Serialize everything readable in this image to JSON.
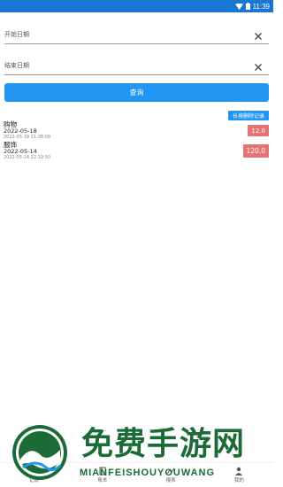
{
  "status_bar": {
    "time": "11:39",
    "icons": [
      "wifi-icon",
      "battery-icon"
    ]
  },
  "filters": {
    "start_date": {
      "placeholder": "开始日期",
      "value": ""
    },
    "end_date": {
      "placeholder": "结束日期",
      "value": ""
    }
  },
  "query_button": {
    "label": "查询"
  },
  "hint": {
    "label": "长按删除记录"
  },
  "records": [
    {
      "title": "购物",
      "date": "2022-05-18",
      "time": "2022-05-19 11:38:09",
      "amount": "12.0"
    },
    {
      "title": "服饰",
      "date": "2022-05-14",
      "time": "2022-05-14 22:19:50",
      "amount": "120.0"
    }
  ],
  "bottom_nav": [
    {
      "label": "记账",
      "icon": "edit-icon"
    },
    {
      "label": "账本",
      "icon": "book-icon"
    },
    {
      "label": "报表",
      "icon": "chart-icon"
    },
    {
      "label": "我的",
      "icon": "user-icon"
    }
  ],
  "watermark": {
    "title": "免费手游网",
    "subtitle": "MIANFEISHOUYOUWANG"
  },
  "colors": {
    "accent": "#2196F3",
    "status_bar": "#1976D2",
    "amount_badge": "#E57373",
    "watermark": "#1a6b35"
  }
}
